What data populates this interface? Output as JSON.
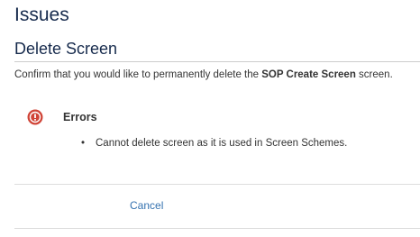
{
  "page": {
    "title": "Issues"
  },
  "dialog": {
    "title": "Delete Screen",
    "confirm_prefix": "Confirm that you would like to permanently delete the ",
    "screen_name": "SOP Create Screen",
    "confirm_suffix": " screen."
  },
  "errors": {
    "icon": "error-icon",
    "heading": "Errors",
    "items": [
      {
        "bullet": "•",
        "text": "Cannot delete screen as it is used in Screen Schemes."
      }
    ]
  },
  "actions": {
    "cancel_label": "Cancel"
  },
  "colors": {
    "heading": "#172b4d",
    "link": "#3572b0",
    "error_red": "#d04437"
  }
}
